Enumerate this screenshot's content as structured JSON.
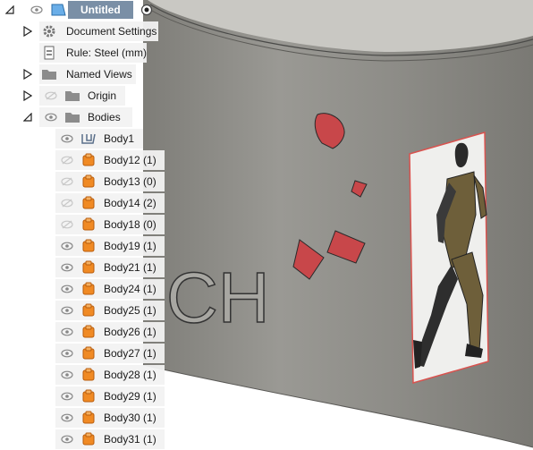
{
  "browser": {
    "root": {
      "label": "Untitled"
    },
    "document_settings": {
      "label": "Document Settings"
    },
    "rule": {
      "label": "Rule: Steel (mm)"
    },
    "named_views": {
      "label": "Named Views"
    },
    "origin": {
      "label": "Origin"
    },
    "bodies": {
      "label": "Bodies",
      "items": [
        {
          "label": "Body1",
          "visible": true,
          "icon": "surface-body-icon"
        },
        {
          "label": "Body12 (1)",
          "visible": false,
          "icon": "solid-body-icon"
        },
        {
          "label": "Body13 (0)",
          "visible": false,
          "icon": "solid-body-icon"
        },
        {
          "label": "Body14 (2)",
          "visible": false,
          "icon": "solid-body-icon"
        },
        {
          "label": "Body18 (0)",
          "visible": false,
          "icon": "solid-body-icon"
        },
        {
          "label": "Body19 (1)",
          "visible": true,
          "icon": "solid-body-icon"
        },
        {
          "label": "Body21 (1)",
          "visible": true,
          "icon": "solid-body-icon"
        },
        {
          "label": "Body24 (1)",
          "visible": true,
          "icon": "solid-body-icon"
        },
        {
          "label": "Body25 (1)",
          "visible": true,
          "icon": "solid-body-icon"
        },
        {
          "label": "Body26 (1)",
          "visible": true,
          "icon": "solid-body-icon"
        },
        {
          "label": "Body27 (1)",
          "visible": true,
          "icon": "solid-body-icon"
        },
        {
          "label": "Body28 (1)",
          "visible": true,
          "icon": "solid-body-icon"
        },
        {
          "label": "Body29 (1)",
          "visible": true,
          "icon": "solid-body-icon"
        },
        {
          "label": "Body30 (1)",
          "visible": true,
          "icon": "solid-body-icon"
        },
        {
          "label": "Body31 (1)",
          "visible": true,
          "icon": "solid-body-icon"
        }
      ]
    }
  },
  "viewport": {
    "embossed_text": "CH"
  },
  "colors": {
    "body_gray": "#8a8984",
    "selection_red": "#d9534f",
    "solid_orange": "#f08a24",
    "root_blue": "#7a8fa6"
  }
}
